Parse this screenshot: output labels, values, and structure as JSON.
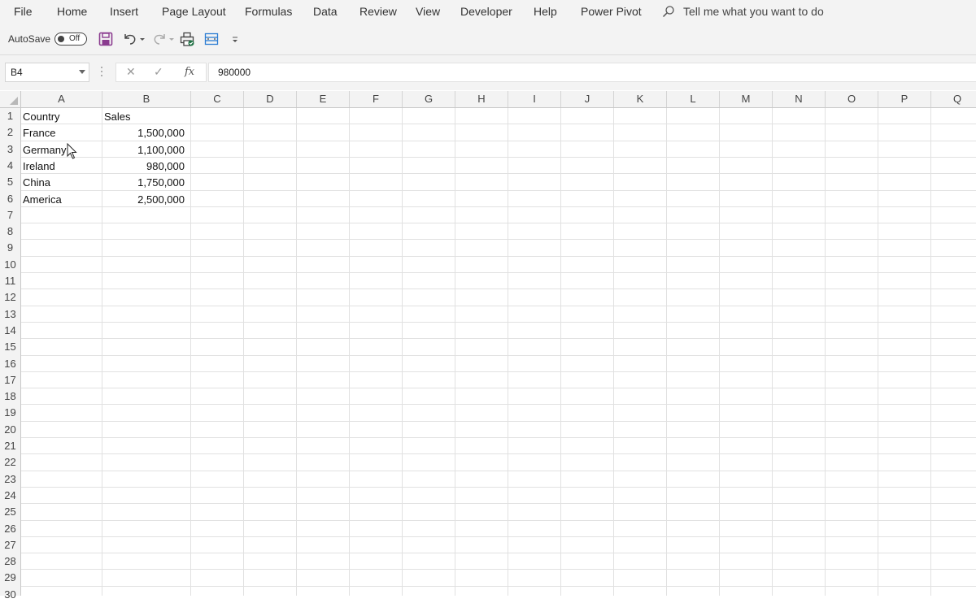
{
  "ribbon": {
    "tabs": [
      "File",
      "Home",
      "Insert",
      "Page Layout",
      "Formulas",
      "Data",
      "Review",
      "View",
      "Developer",
      "Help",
      "Power Pivot"
    ],
    "tell_me": "Tell me what you want to do"
  },
  "qat": {
    "autosave_label": "AutoSave",
    "autosave_state": "Off"
  },
  "formula_bar": {
    "name_box": "B4",
    "cancel_glyph": "✕",
    "enter_glyph": "✓",
    "fx_label": "fx",
    "formula": "980000"
  },
  "columns": [
    "A",
    "B",
    "C",
    "D",
    "E",
    "F",
    "G",
    "H",
    "I",
    "J",
    "K",
    "L",
    "M",
    "N",
    "O",
    "P",
    "Q"
  ],
  "rows": [
    "1",
    "2",
    "3",
    "4",
    "5",
    "6",
    "7",
    "8",
    "9",
    "10",
    "11",
    "12",
    "13",
    "14",
    "15",
    "16",
    "17",
    "18",
    "19",
    "20",
    "21",
    "22",
    "23",
    "24",
    "25",
    "26",
    "27",
    "28",
    "29",
    "30"
  ],
  "sheet": {
    "header": {
      "country": "Country",
      "sales": "Sales"
    },
    "data": [
      {
        "country": "France",
        "sales": "1,500,000"
      },
      {
        "country": "Germany",
        "sales": "1,100,000"
      },
      {
        "country": "Ireland",
        "sales": "980,000"
      },
      {
        "country": "China",
        "sales": "1,750,000"
      },
      {
        "country": "America",
        "sales": "2,500,000"
      }
    ]
  },
  "colors": {
    "chrome": "#f3f3f3",
    "gridline": "#e1e1e1",
    "save_icon": "#8a3b8f",
    "accent": "#217346"
  }
}
